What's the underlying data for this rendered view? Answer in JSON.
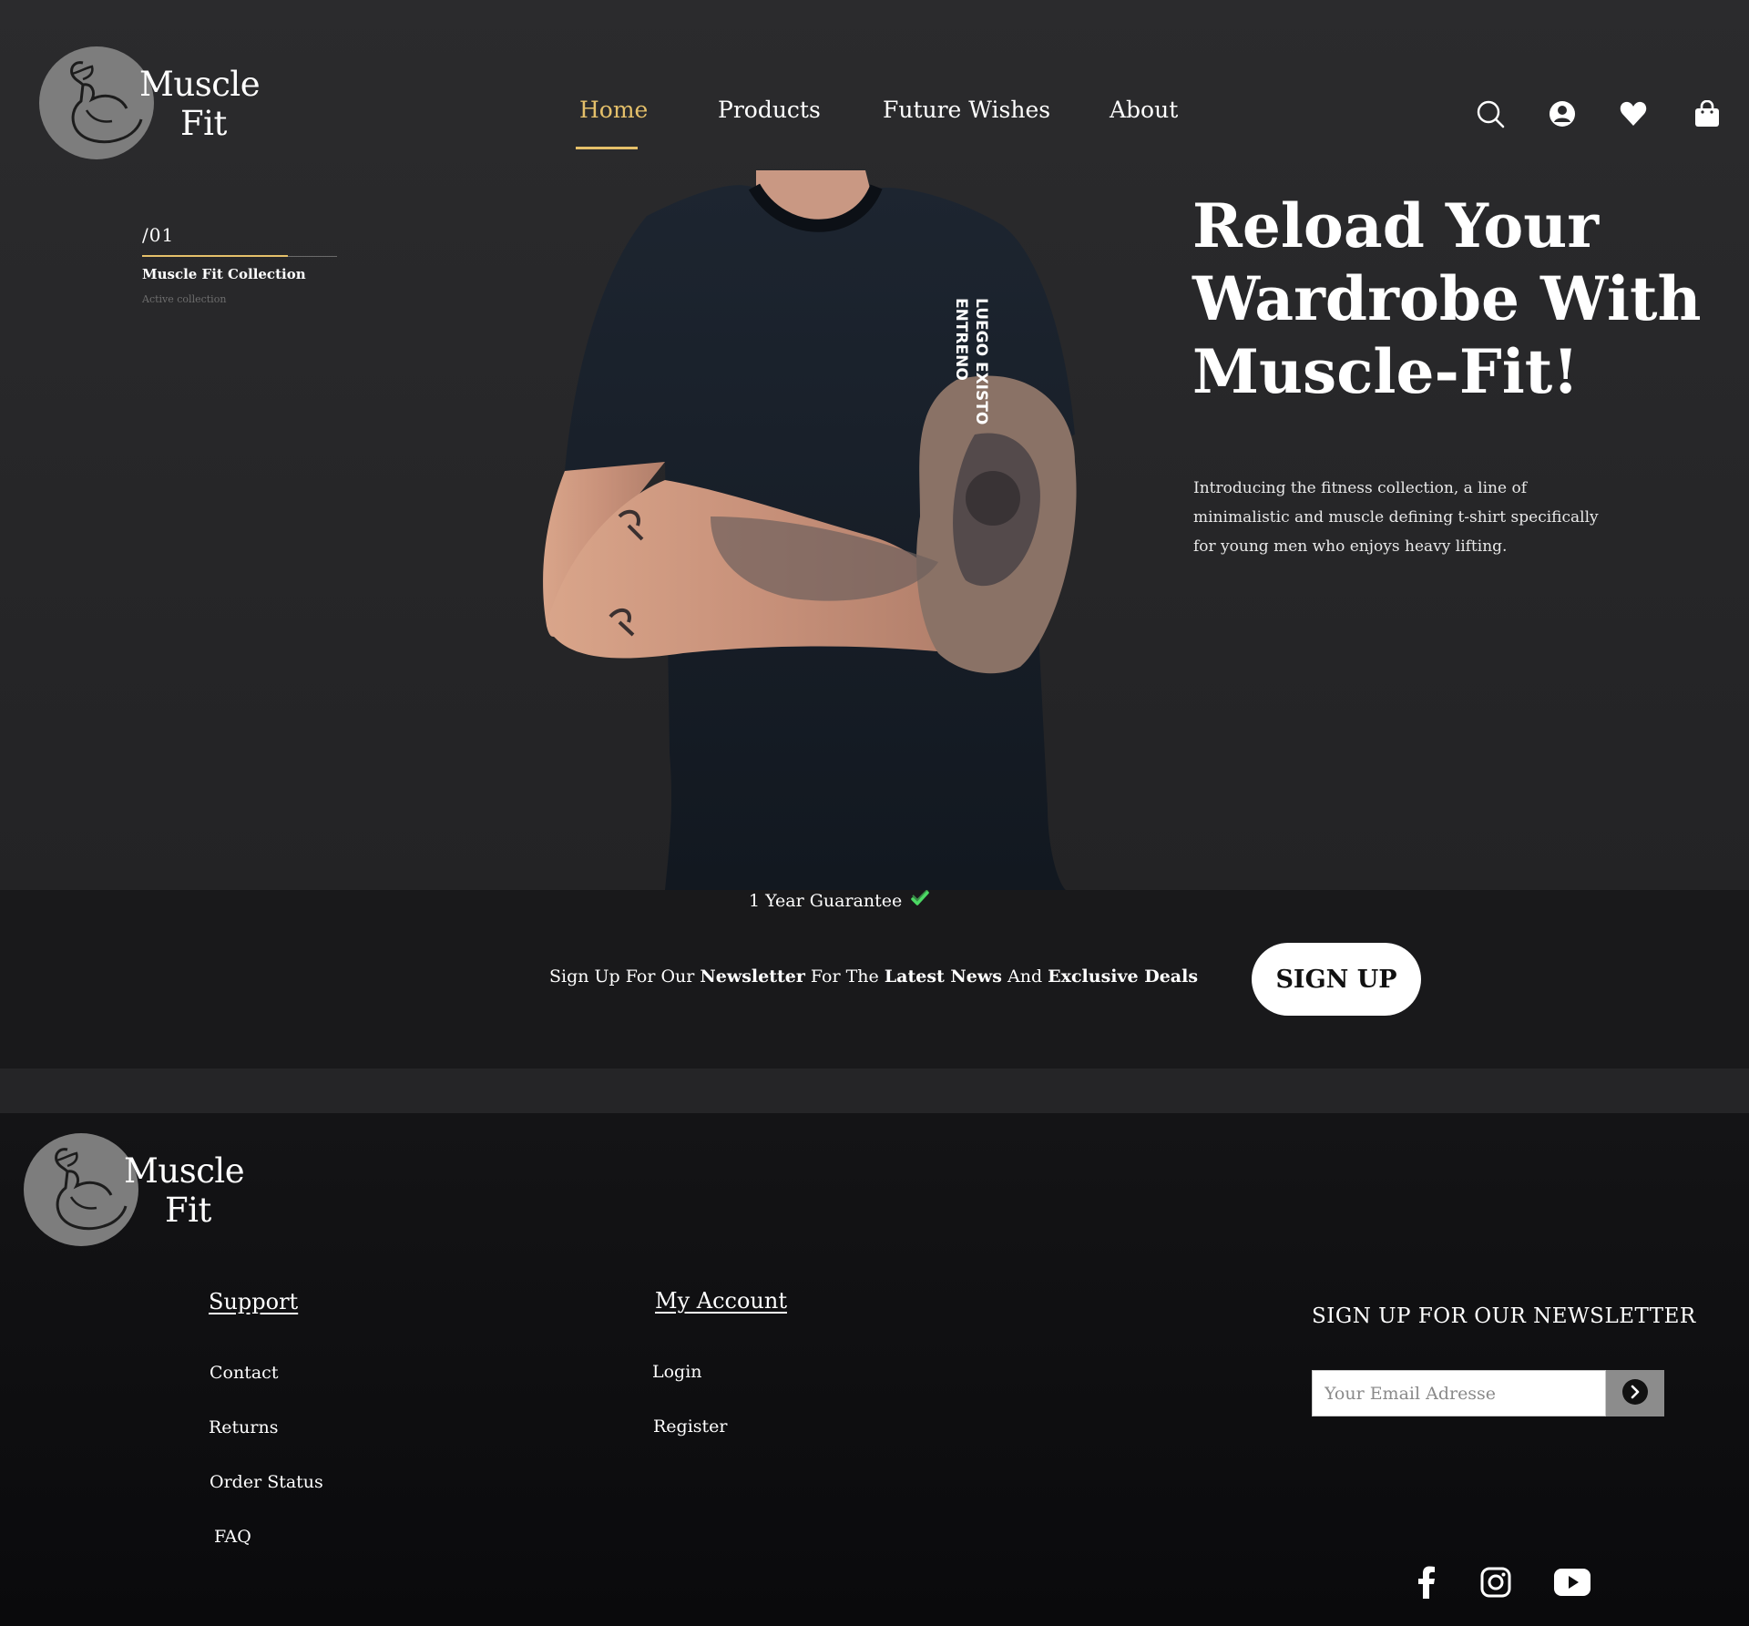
{
  "brand": {
    "line1": "Muscle",
    "line2": "Fit"
  },
  "nav": {
    "items": [
      {
        "label": "Home",
        "active": true
      },
      {
        "label": "Products",
        "active": false
      },
      {
        "label": "Future Wishes",
        "active": false
      },
      {
        "label": "About",
        "active": false
      }
    ]
  },
  "header_icons": [
    "search-icon",
    "user-icon",
    "heart-icon",
    "shopping-bag-icon"
  ],
  "slider": {
    "number": "/01",
    "title": "Muscle Fit Collection",
    "subtitle": "Active collection"
  },
  "hero": {
    "title": "Reload Your Wardrobe With Muscle-Fit!",
    "description": "Introducing the fitness collection, a line of minimalistic and muscle defining t-shirt specifically for young men who enjoys heavy lifting.",
    "shirt_print_1": "ENTRENO",
    "shirt_print_2": "LUEGO EXISTO"
  },
  "band": {
    "guarantee": "1 Year Guarantee",
    "text_1": "Sign Up For Our ",
    "text_2": "Newsletter",
    "text_3": " For The ",
    "text_4": "Latest News",
    "text_5": " And ",
    "text_6": "Exclusive Deals",
    "button": "SIGN UP"
  },
  "footer": {
    "support": {
      "heading": "Support",
      "links": [
        "Contact",
        "Returns",
        "Order Status",
        "FAQ"
      ]
    },
    "account": {
      "heading": "My Account",
      "links": [
        "Login",
        "Register"
      ]
    },
    "newsletter": {
      "heading": "SIGN UP FOR OUR NEWSLETTER",
      "placeholder": "Your Email Adresse"
    },
    "social": [
      "facebook-icon",
      "instagram-icon",
      "youtube-icon"
    ]
  },
  "colors": {
    "accent": "#e5c06a",
    "background": "#2a2a2c",
    "band": "#19191b",
    "footer": "#0e0e10",
    "check": "#4cd964"
  }
}
